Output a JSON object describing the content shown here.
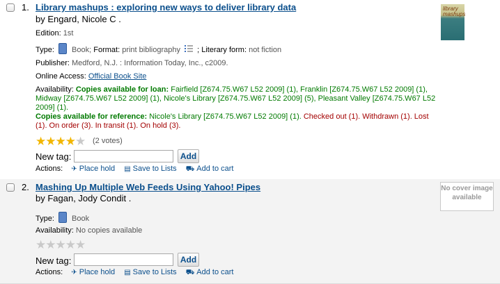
{
  "results": [
    {
      "number": "1.",
      "title": "Library mashups : exploring new ways to deliver library data",
      "author": "by Engard, Nicole C .",
      "edition_label": "Edition:",
      "edition": "1st",
      "type_label": "Type:",
      "type": "Book;",
      "format_label": "Format:",
      "format": "print bibliography",
      "literary_form_label": "; Literary form:",
      "literary_form": "not fiction",
      "publisher_label": "Publisher:",
      "publisher": "Medford, N.J. : Information Today, Inc., c2009.",
      "online_access_label": "Online Access:",
      "online_access_link": "Official Book Site",
      "availability_label": "Availability:",
      "loan_label": "Copies available for loan:",
      "loan_copies": "Fairfield [Z674.75.W67 L52 2009] (1), Franklin [Z674.75.W67 L52 2009] (1), Midway [Z674.75.W67 L52 2009] (1), Nicole's Library [Z674.75.W67 L52 2009] (5), Pleasant Valley [Z674.75.W67 L52 2009] (1).",
      "reference_label": "Copies available for reference:",
      "reference_copies": "Nicole's Library [Z674.75.W67 L52 2009] (1).",
      "unavailable": "Checked out (1). Withdrawn (1). Lost (1). On order (3). In transit (1). On hold (3).",
      "rating": 4,
      "votes": "(2 votes)",
      "cover_text": "library mashups"
    },
    {
      "number": "2.",
      "title": "Mashing Up Multiple Web Feeds Using Yahoo! Pipes",
      "author": "by Fagan, Jody Condit .",
      "type_label": "Type:",
      "type": "Book",
      "availability_label": "Availability:",
      "availability": "No copies available",
      "rating": 0,
      "no_cover": "No cover image available"
    }
  ],
  "common": {
    "new_tag_label": "New tag:",
    "add_button": "Add",
    "actions_label": "Actions:",
    "place_hold": "Place hold",
    "save_to_lists": "Save to Lists",
    "add_to_cart": "Add to cart",
    "stars": "★★★★★"
  },
  "colors": {
    "link": "#0b4f8c",
    "available": "#017a00",
    "unavailable": "#a30000",
    "row_alt": "#f3f3f3",
    "star": "#f2b600"
  },
  "icons": [
    "checkbox",
    "book-icon",
    "list-format-icon",
    "place-hold-icon",
    "save-to-lists-icon",
    "add-to-cart-icon",
    "star-icon"
  ]
}
